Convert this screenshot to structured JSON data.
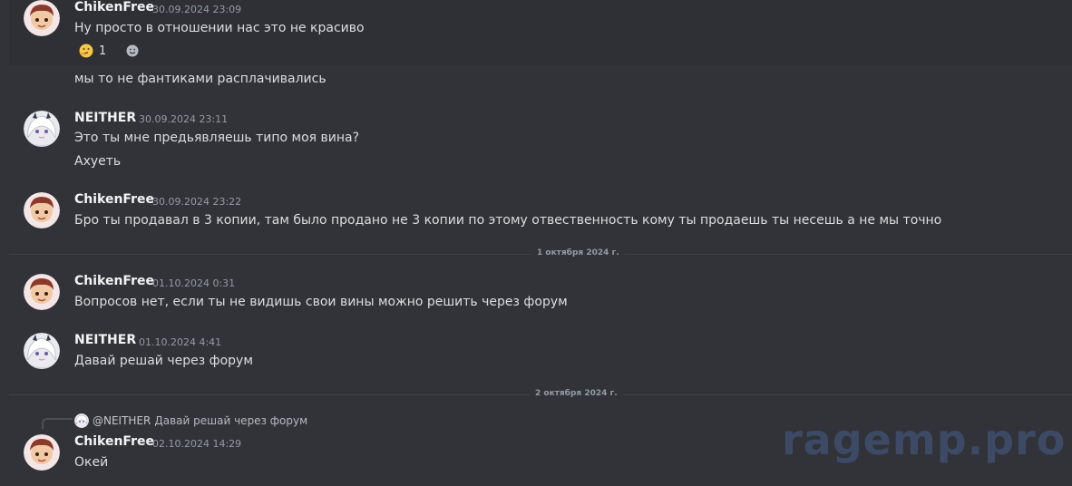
{
  "toolbar": {
    "icons": [
      "check-icon",
      "double-tick-icon",
      "close-icon",
      "refresh-icon",
      "chevron-icon"
    ]
  },
  "messages": [
    {
      "author": "ChikenFree",
      "timestamp": "30.09.2024 23:09",
      "lines": [
        "Ну просто в отношении нас это не красиво"
      ],
      "reaction": {
        "emoji": "thinking-face",
        "count": "1"
      }
    },
    {
      "lines": [
        "мы то не фантиками расплачивались"
      ]
    },
    {
      "author": "NEITHER",
      "timestamp": "30.09.2024 23:11",
      "lines": [
        "Это ты мне предьявляешь типо моя вина?",
        "Ахуеть"
      ]
    },
    {
      "author": "ChikenFree",
      "timestamp": "30.09.2024 23:22",
      "lines": [
        "Бро ты продавал в 3 копии, там было продано не 3 копии по этому отвественность кому ты продаешь ты несешь а не мы точно"
      ]
    },
    {
      "author": "ChikenFree",
      "timestamp": "01.10.2024 0:31",
      "lines": [
        "Вопросов нет, если ты не видишь свои вины можно решить через форум"
      ]
    },
    {
      "author": "NEITHER",
      "timestamp": "01.10.2024 4:41",
      "lines": [
        "Давай решай через форум"
      ]
    },
    {
      "reply": {
        "author": "@NEITHER",
        "text": "Давай решай через форум"
      },
      "author": "ChikenFree",
      "timestamp": "02.10.2024 14:29",
      "lines": [
        "Окей"
      ]
    }
  ],
  "dividers": [
    "1 октября 2024 г.",
    "2 октября 2024 г."
  ],
  "watermark": "ragemp.pro",
  "colors": {
    "background": "#313338",
    "author": "#f2f3f5",
    "text": "#dbdee1",
    "muted": "#949ba4"
  }
}
